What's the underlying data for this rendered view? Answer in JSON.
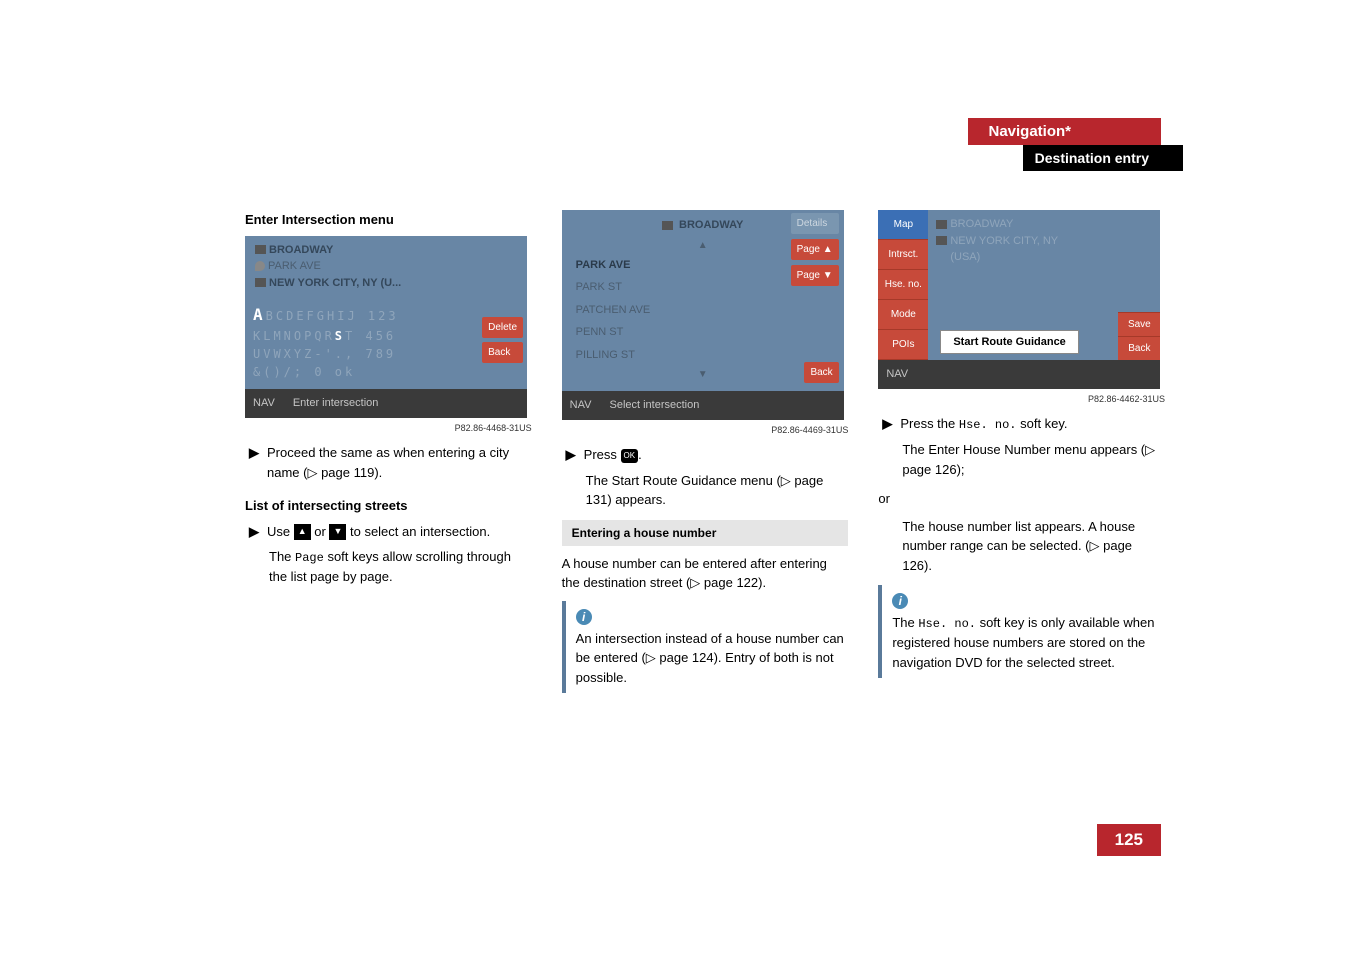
{
  "header": {
    "chapter": "Navigation*",
    "section": "Destination entry"
  },
  "pageNumber": "125",
  "col1": {
    "heading": "Enter Intersection menu",
    "screenshot1": {
      "infoLine1Icon": "flag",
      "infoLine1": "BROADWAY",
      "infoLine2Icon": "dest",
      "infoLine2": "PARK AVE",
      "infoLine3Icon": "city",
      "infoLine3": "NEW YORK CITY, NY (U...",
      "kbA": "A",
      "kbRow1Rest": "BCDEFGHIJ  123",
      "kbRow2a": "KLMNOPQR",
      "kbRow2S": "S",
      "kbRow2b": "T   456",
      "kbRow3": "UVWXYZ-'.,  789",
      "kbRow4": "&()/;       0 ok",
      "deleteKey": "Delete",
      "backKey": "Back",
      "footerNav": "NAV",
      "footerText": "Enter intersection",
      "caption": "P82.86-4468-31US"
    },
    "step1": "Proceed the same as when entering a city name (▷ page 119).",
    "heading2": "List of intersecting streets",
    "step2a": "Use ",
    "step2b": " or ",
    "step2c": " to select an intersection.",
    "step2Extra": "The Page soft keys allow scrolling through the list page by page.",
    "pageKey": "Page"
  },
  "col2": {
    "screenshot2": {
      "headerIcon": "flag",
      "headerText": "BROADWAY",
      "detailsKey": "Details",
      "items": [
        "PARK AVE",
        "PARK ST",
        "PATCHEN AVE",
        "PENN ST",
        "PILLING ST"
      ],
      "pageUpKey": "Page ▲",
      "pageDownKey": "Page ▼",
      "backKey": "Back",
      "footerNav": "NAV",
      "footerText": "Select intersection",
      "caption": "P82.86-4469-31US"
    },
    "step1a": "Press ",
    "step1b": ".",
    "step1Extra": "The Start Route Guidance menu (▷ page 131) appears.",
    "subsection": "Entering a house number",
    "para1": "A house number can be entered after entering the destination street (▷ page 122).",
    "infoText": "An intersection instead of a house number can be entered (▷ page 124). Entry of both is not possible."
  },
  "col3": {
    "screenshot3": {
      "sidekeys": [
        "Map",
        "Intrsct.",
        "Hse. no.",
        "Mode",
        "POIs"
      ],
      "line1Icon": "flag",
      "line1": "BROADWAY",
      "line2Icon": "city",
      "line2": "NEW YORK CITY, NY",
      "line3": "(USA)",
      "routeBtn": "Start Route Guidance",
      "saveKey": "Save",
      "backKey": "Back",
      "footerNav": "NAV",
      "caption": "P82.86-4462-31US"
    },
    "step1a": "Press the ",
    "step1Mono": "Hse. no.",
    "step1b": " soft key.",
    "step1Extra": "The Enter House Number menu appears (▷ page 126);",
    "or": "or",
    "step2": "The house number list appears. A house number range can be selected. (▷ page 126).",
    "infoA": "The ",
    "infoMono": "Hse. no.",
    "infoB": " soft key is only available when registered house numbers are stored on the navigation DVD for the selected street."
  }
}
